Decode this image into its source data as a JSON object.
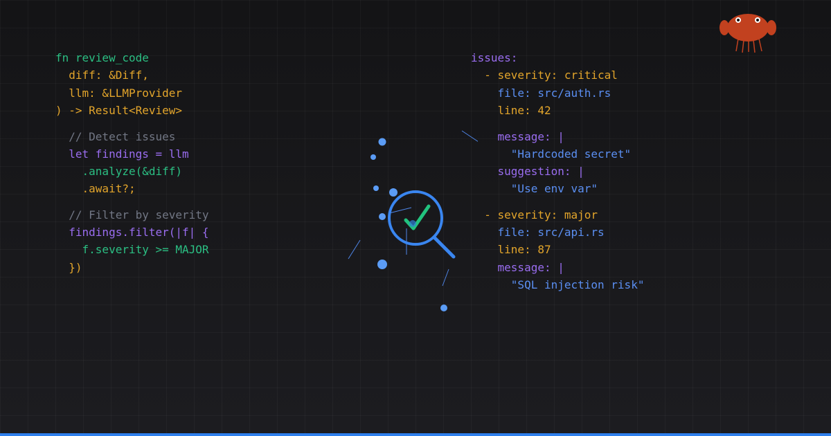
{
  "code_left": {
    "lines": [
      "fn review_code",
      "  diff: &Diff,",
      "  llm: &LLMProvider",
      ") -> Result<Review>",
      "  // Detect issues",
      "  let findings = llm",
      "    .analyze(&diff)",
      "    .await?;",
      "  // Filter by severity",
      "  findings.filter(|f| {",
      "    f.severity >= MAJOR",
      "  })"
    ]
  },
  "code_right": {
    "lines": [
      "issues:",
      "  - severity: critical",
      "    file: src/auth.rs",
      "    line: 42",
      "    message: |",
      "      \"Hardcoded secret\"",
      "    suggestion: |",
      "      \"Use env var\"",
      "  - severity: major",
      "    file: src/api.rs",
      "    line: 87",
      "    message: |",
      "      \"SQL injection risk\""
    ]
  },
  "icons": {
    "center": "magnifier-check-icon",
    "mascot": "crab-mascot-icon"
  },
  "colors": {
    "background": "#17171a",
    "keyword_green": "#2bbf83",
    "amber": "#e3a52b",
    "comment_gray": "#727785",
    "purple": "#9a6df0",
    "blue": "#5b8ff2",
    "accent_bar": "#2f80ed",
    "crab": "#c2411f"
  }
}
